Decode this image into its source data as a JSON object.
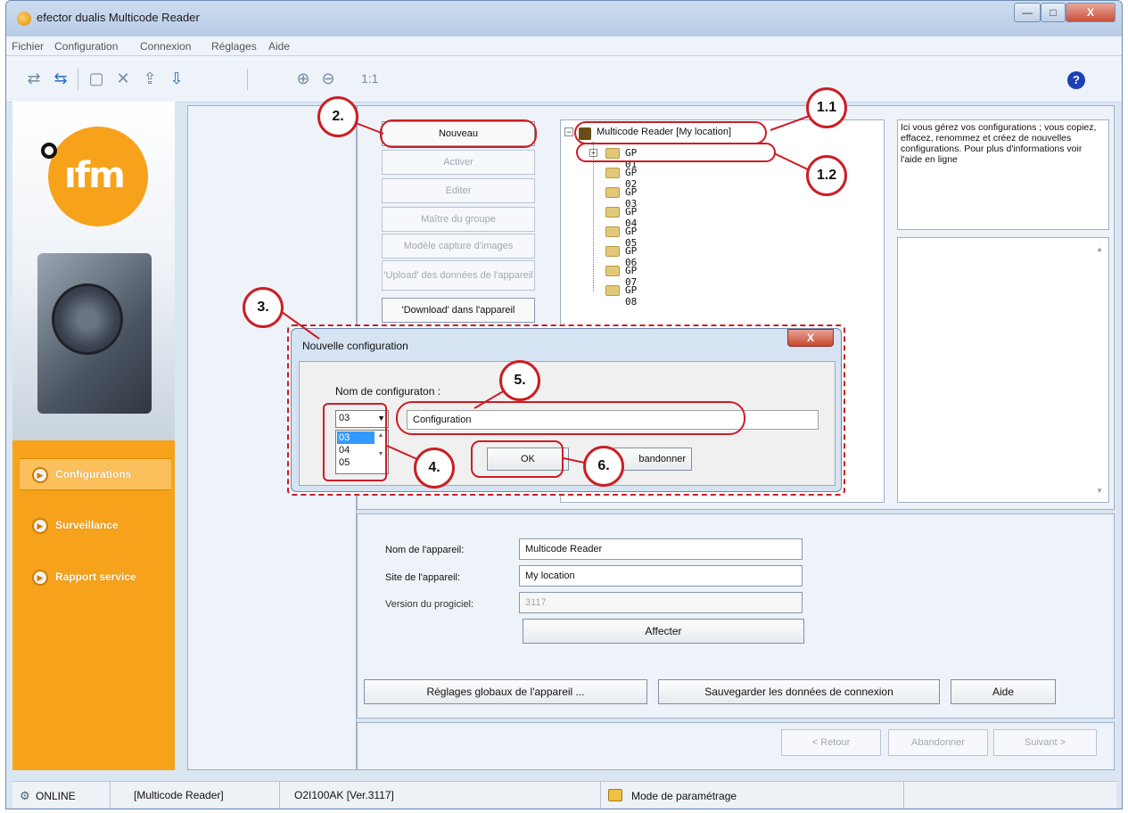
{
  "window": {
    "title": "efector dualis Multicode Reader",
    "buttons": {
      "minimize": "—",
      "maximize": "□",
      "close": "X"
    }
  },
  "menu": [
    "Fichier",
    "Configuration",
    "Connexion",
    "Réglages",
    "Aide"
  ],
  "toolbar": {
    "zoom_reset": "1:1",
    "help": "?"
  },
  "sidebar": {
    "items": [
      {
        "label": "Configurations",
        "active": true
      },
      {
        "label": "Surveillance",
        "active": false
      },
      {
        "label": "Rapport service",
        "active": false
      }
    ]
  },
  "actions": {
    "nouveau": "Nouveau",
    "activer": "Activer",
    "editer": "Editer",
    "maitre": "Maître du groupe",
    "modele": "Modèle capture d'images",
    "upload": "'Upload' des données de l'appareil",
    "download": "'Download' dans l'appareil"
  },
  "tree": {
    "root": "Multicode Reader [My location]",
    "nodes": [
      "GP 01",
      "GP 02",
      "GP 03",
      "GP 04",
      "GP 05",
      "GP 06",
      "GP 07",
      "GP 08"
    ],
    "expand_root": "−",
    "expand_node": "+"
  },
  "help_text": "Ici vous gérez vos configurations ; vous copiez, effacez, renommez et créez de nouvelles configurations. Pour plus d'informations voir l'aide en ligne",
  "device": {
    "name_label": "Nom de l'appareil:",
    "name_value": "Multicode Reader",
    "site_label": "Site de l'appareil:",
    "site_value": "My location",
    "version_label": "Version du progiciel:",
    "version_value": "3117",
    "affecter": "Affecter"
  },
  "bottom_buttons": {
    "reglages": "Réglages globaux de l'appareil ...",
    "sauvegarder": "Sauvegarder les données de connexion",
    "aide": "Aide"
  },
  "wizard": {
    "retour": "< Retour",
    "abandonner": "Abandonner",
    "suivant": "Suivant >"
  },
  "status": {
    "online": "ONLINE",
    "device": "[Multicode Reader]",
    "firmware": "O2I100AK [Ver.3117]",
    "mode": "Mode de paramétrage"
  },
  "modal": {
    "title": "Nouvelle configuration",
    "close": "X",
    "name_label": "Nom de configuraton :",
    "selected": "03",
    "options": [
      "03",
      "04",
      "05"
    ],
    "input_value": "Configuration",
    "ok": "OK",
    "cancel": "Abandonner",
    "cancel_visible": "bandonner"
  },
  "callouts": [
    "1.1",
    "1.2",
    "2.",
    "3.",
    "4.",
    "5.",
    "6."
  ],
  "colors": {
    "accent_orange": "#f7a21b",
    "annotation_red": "#cc1d24",
    "window_blue": "#dbe6f3"
  }
}
